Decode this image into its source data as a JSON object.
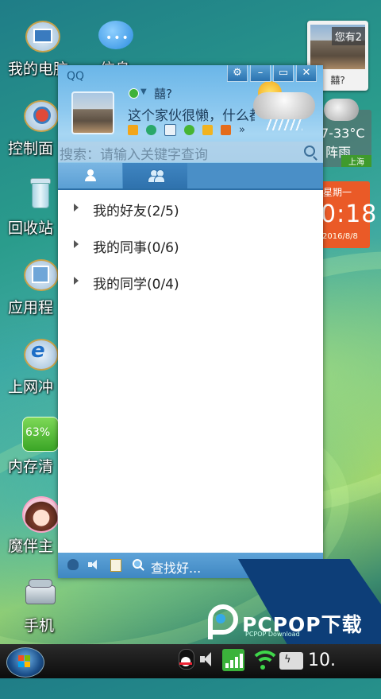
{
  "desktop": {
    "icons": [
      {
        "label": "我的电脑",
        "icon": "computer-icon"
      },
      {
        "label": "信息",
        "icon": "message-bubble-icon"
      },
      {
        "label": "控制面",
        "icon": "control-panel-icon"
      },
      {
        "label": "回收站",
        "icon": "recycle-bin-icon"
      },
      {
        "label": "应用程",
        "icon": "apps-icon"
      },
      {
        "label": "上网冲",
        "icon": "internet-explorer-icon"
      },
      {
        "label": "内存清",
        "icon": "memory-cleaner-icon",
        "badge": "63%"
      },
      {
        "label": "魔伴主",
        "icon": "avatar-girl-icon"
      },
      {
        "label": "手机",
        "icon": "telephone-icon"
      }
    ]
  },
  "widgets": {
    "photo": {
      "note": "您有2",
      "caption": "囍?"
    },
    "weather": {
      "temp": "7-33°C",
      "condition": "阵雨",
      "city": "上海"
    },
    "clock": {
      "day": "星期一",
      "time": "0:18",
      "date": "2016/8/8"
    }
  },
  "qq": {
    "title": "QQ",
    "nickname": "囍?",
    "signature": "这个家伙很懒，什么都",
    "search_placeholder": "搜索：请输入关键字查询",
    "groups": [
      {
        "label": "我的好友(2/5)"
      },
      {
        "label": "我的同事(0/6)"
      },
      {
        "label": "我的同学(0/4)"
      }
    ],
    "footer_find": "查找好..."
  },
  "taskbar": {
    "clock": "10."
  },
  "watermark": {
    "brand": "PCPOP下载",
    "sub": "PCPOP Download"
  },
  "colors": {
    "qq_blue": "#4a8fc7",
    "clock_orange": "#ea5a27",
    "watermark_navy": "#0d3e78"
  }
}
